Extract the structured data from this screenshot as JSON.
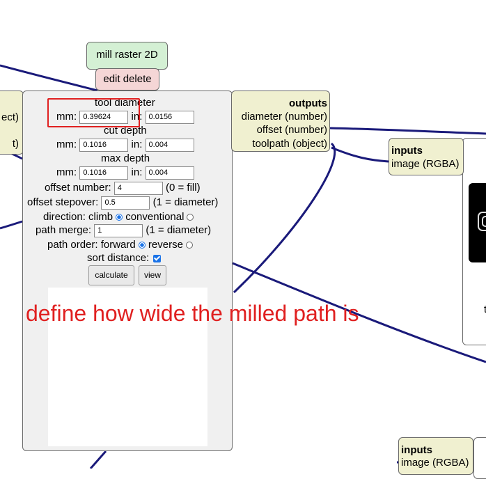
{
  "node": {
    "title": "mill raster 2D",
    "edit_label": "edit",
    "delete_label": "delete"
  },
  "left_outputs": {
    "item1": "ect)",
    "item2": "t)"
  },
  "fields": {
    "tool_diameter_heading": "tool diameter",
    "tool_mm_label": "mm:",
    "tool_mm_value": "0.39624",
    "tool_in_label": "in:",
    "tool_in_value": "0.0156",
    "cut_depth_heading": "cut depth",
    "cut_mm_label": "mm:",
    "cut_mm_value": "0.1016",
    "cut_in_label": "in:",
    "cut_in_value": "0.004",
    "max_depth_heading": "max depth",
    "max_mm_label": "mm:",
    "max_mm_value": "0.1016",
    "max_in_label": "in:",
    "max_in_value": "0.004",
    "offset_number_label": "offset number:",
    "offset_number_value": "4",
    "offset_number_hint": "(0 = fill)",
    "offset_stepover_label": "offset stepover:",
    "offset_stepover_value": "0.5",
    "offset_stepover_hint": "(1 = diameter)",
    "direction_label": "direction: climb",
    "direction_conventional": "conventional",
    "path_merge_label": "path merge:",
    "path_merge_value": "1",
    "path_merge_hint": "(1 = diameter)",
    "path_order_label": "path order: forward",
    "path_order_reverse": "reverse",
    "sort_distance_label": "sort distance:",
    "calculate_label": "calculate",
    "view_label": "view"
  },
  "outputs": {
    "heading": "outputs",
    "item1": "diameter (number)",
    "item2": "offset (number)",
    "item3": "toolpath (object)"
  },
  "inputs_top": {
    "heading": "inputs",
    "item1": "image (RGBA)"
  },
  "inputs_bottom": {
    "heading": "inputs",
    "item1": "image (RGBA)"
  },
  "right_panel": {
    "partial_text": "t"
  },
  "annotation": {
    "text": "define how wide the milled path is"
  },
  "colors": {
    "wire": "#1a1a7a",
    "annotation": "#e02020",
    "title_bg": "#d4f0d4",
    "edit_bg": "#f5d6d6",
    "io_bg": "#f0f0d0",
    "panel_bg": "#f0f0f0"
  }
}
